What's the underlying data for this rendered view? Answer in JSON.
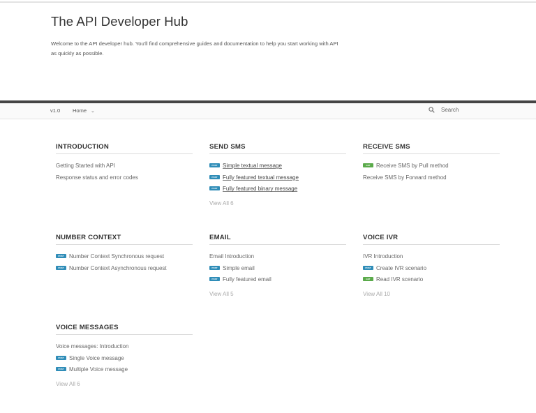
{
  "hero": {
    "title": "The API Developer Hub",
    "description": "Welcome to the API developer hub. You'll find comprehensive guides and documentation to help you start working with API as quickly as possible."
  },
  "nav": {
    "version": "v1.0",
    "home": "Home",
    "search_label": "Search"
  },
  "badges": {
    "post": "POST",
    "get": "GET"
  },
  "sections": {
    "introduction": {
      "title": "INTRODUCTION",
      "items": [
        {
          "label": "Getting Started with API",
          "method": ""
        },
        {
          "label": "Response status and error codes",
          "method": ""
        }
      ],
      "view_all": ""
    },
    "send_sms": {
      "title": "SEND SMS",
      "items": [
        {
          "label": "Simple textual message",
          "method": "post"
        },
        {
          "label": "Fully featured textual message",
          "method": "post"
        },
        {
          "label": "Fully featured binary message",
          "method": "post"
        }
      ],
      "view_all": "View All 6"
    },
    "receive_sms": {
      "title": "RECEIVE SMS",
      "items": [
        {
          "label": "Receive SMS by Pull method",
          "method": "get"
        },
        {
          "label": "Receive SMS by Forward method",
          "method": ""
        }
      ],
      "view_all": ""
    },
    "number_context": {
      "title": "NUMBER CONTEXT",
      "items": [
        {
          "label": "Number Context Synchronous request",
          "method": "post"
        },
        {
          "label": "Number Context Asynchronous request",
          "method": "post"
        }
      ],
      "view_all": ""
    },
    "email": {
      "title": "EMAIL",
      "items": [
        {
          "label": "Email Introduction",
          "method": ""
        },
        {
          "label": "Simple email",
          "method": "post"
        },
        {
          "label": "Fully featured email",
          "method": "post"
        }
      ],
      "view_all": "View All 5"
    },
    "voice_ivr": {
      "title": "VOICE IVR",
      "items": [
        {
          "label": "IVR Introduction",
          "method": ""
        },
        {
          "label": "Create IVR scenario",
          "method": "post"
        },
        {
          "label": "Read IVR scenario",
          "method": "get"
        }
      ],
      "view_all": "View All 10"
    },
    "voice_messages": {
      "title": "VOICE MESSAGES",
      "items": [
        {
          "label": "Voice messages: Introduction",
          "method": ""
        },
        {
          "label": "Single Voice message",
          "method": "post"
        },
        {
          "label": "Multiple Voice message",
          "method": "post"
        }
      ],
      "view_all": "View All 6"
    }
  }
}
